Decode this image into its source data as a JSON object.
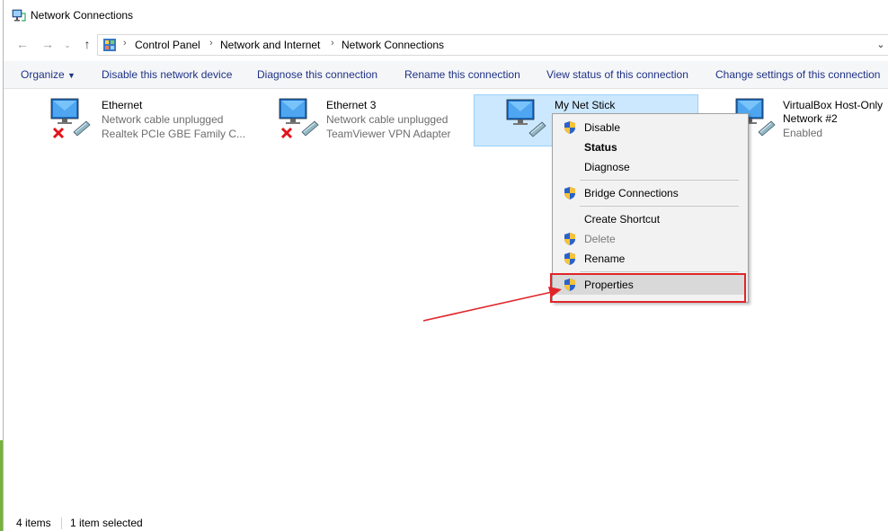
{
  "window": {
    "title": "Network Connections"
  },
  "address": {
    "crumbs": [
      "Control Panel",
      "Network and Internet",
      "Network Connections"
    ]
  },
  "toolbar": {
    "organize": "Organize",
    "disable": "Disable this network device",
    "diagnose": "Diagnose this connection",
    "rename": "Rename this connection",
    "view_status": "View status of this connection",
    "change_settings": "Change settings of this connection"
  },
  "items": [
    {
      "name": "Ethernet",
      "status": "Network cable unplugged",
      "device": "Realtek PCIe GBE Family C..."
    },
    {
      "name": "Ethernet 3",
      "status": "Network cable unplugged",
      "device": "TeamViewer VPN Adapter"
    },
    {
      "name": "My Net Stick"
    },
    {
      "name": "VirtualBox Host-Only",
      "name2": "Network #2",
      "status": "Enabled"
    }
  ],
  "context_menu": {
    "disable": "Disable",
    "status": "Status",
    "diagnose": "Diagnose",
    "bridge": "Bridge Connections",
    "shortcut": "Create Shortcut",
    "delete": "Delete",
    "rename": "Rename",
    "properties": "Properties"
  },
  "statusbar": {
    "count": "4 items",
    "selected": "1 item selected"
  },
  "colors": {
    "accent": "#1e3287",
    "selection": "#cce8ff",
    "highlight_box": "#e0252a"
  }
}
